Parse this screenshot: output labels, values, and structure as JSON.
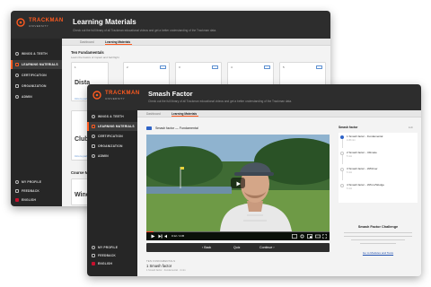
{
  "brand": {
    "name": "TRACKMAN",
    "sub": "UNIVERSITY",
    "color": "#ff5a1f"
  },
  "back_window": {
    "title": "Learning Materials",
    "subtitle": "Check out the full library of all Trackman educational videos and get a better understanding of the Trackman data.",
    "sidebar": [
      {
        "label": "WINGS & TEETH",
        "icon": "wing-icon"
      },
      {
        "label": "LEARNING MATERIALS",
        "icon": "book-icon",
        "active": true
      },
      {
        "label": "CERTIFICATION",
        "icon": "badge-icon"
      },
      {
        "label": "ORGANIZATION",
        "icon": "org-icon"
      },
      {
        "label": "ADMIN",
        "icon": "admin-icon"
      }
    ],
    "sidebar_bottom": [
      {
        "label": "MY PROFILE",
        "icon": "user-icon"
      },
      {
        "label": "FEEDBACK",
        "icon": "feedback-icon"
      },
      {
        "label": "ENGLISH",
        "icon": "flag-icon"
      }
    ],
    "tabs": [
      {
        "label": "Dashboard"
      },
      {
        "label": "Learning Materials",
        "active": true
      }
    ],
    "section_title": "Ten Fundamentals",
    "section_sub": "Learn the basics of impact and ball flight",
    "cards": [
      {
        "num": "1",
        "title": "Dista",
        "tag": "Intro to part"
      },
      {
        "num": "2",
        "title": "",
        "tag": ""
      },
      {
        "num": "3",
        "title": "",
        "tag": ""
      },
      {
        "num": "4",
        "title": "",
        "tag": ""
      },
      {
        "num": "5",
        "title": "",
        "tag": ""
      },
      {
        "num": "",
        "title": "Club",
        "tag": "Intro to part"
      }
    ],
    "course_section": "Course M",
    "course_card_title": "Wind"
  },
  "front_window": {
    "title": "Smash Factor",
    "subtitle": "Check out the full library of all Trackman educational videos and get a better understanding of the Trackman data.",
    "sidebar": [
      {
        "label": "WINGS & TEETH",
        "icon": "wing-icon"
      },
      {
        "label": "LEARNING MATERIALS",
        "icon": "book-icon",
        "active": true
      },
      {
        "label": "CERTIFICATION",
        "icon": "badge-icon"
      },
      {
        "label": "ORGANIZATION",
        "icon": "org-icon"
      },
      {
        "label": "ADMIN",
        "icon": "admin-icon"
      }
    ],
    "sidebar_bottom": [
      {
        "label": "MY PROFILE",
        "icon": "user-icon"
      },
      {
        "label": "FEEDBACK",
        "icon": "feedback-icon"
      },
      {
        "label": "ENGLISH",
        "icon": "flag-icon"
      }
    ],
    "tabs": [
      {
        "label": "Dashboard"
      },
      {
        "label": "Learning Materials",
        "active": true
      }
    ],
    "lesson_title": "Smash factor — Fundamental",
    "video": {
      "time": "0:12 / 4:45",
      "progress": 0.04
    },
    "nav": {
      "back": "Back",
      "quiz": "Quiz",
      "continue": "Continue"
    },
    "below": {
      "label": "TEN FUNDAMENTALS",
      "title": "1 Smash factor",
      "meta": "1 Smash factor · Fundamental · 4 min"
    },
    "panel": {
      "title": "Smash factor",
      "edit": "Edit",
      "items": [
        {
          "title": "1 Smash factor - Fundamental",
          "meta": "4:45 min",
          "active": true
        },
        {
          "title": "2 Smash factor - Ultimate",
          "meta": "5 min",
          "active": false
        },
        {
          "title": "3 Smash factor - W/Driver",
          "meta": "6 min",
          "active": false
        },
        {
          "title": "4 Smash factor - W/Iron/Wedge",
          "meta": "6 min",
          "active": false
        }
      ]
    },
    "challenge": {
      "title": "Smash Factor Challenge",
      "link": "Go to Modules and Tests"
    }
  }
}
